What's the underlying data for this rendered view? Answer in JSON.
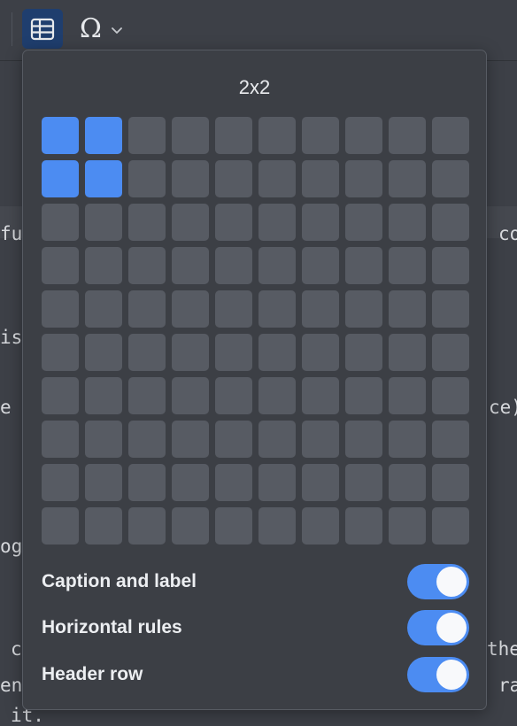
{
  "toolbar": {
    "table_button_icon": "table-grid-icon",
    "special_char_icon": "omega-icon",
    "special_char_glyph": "Ω",
    "dropdown_icon": "chevron-down-icon"
  },
  "background_text": [
    {
      "text": "fu"
    },
    {
      "text": "co"
    },
    {
      "text": "is"
    },
    {
      "text": "e"
    },
    {
      "text": "ce)"
    },
    {
      "text": "og"
    },
    {
      "text": "c"
    },
    {
      "text": "the"
    },
    {
      "text": "en"
    },
    {
      "text": "ra"
    },
    {
      "text": "it."
    }
  ],
  "table_picker": {
    "size_label": "2x2",
    "columns": 10,
    "rows": 10,
    "selected_cols": 2,
    "selected_rows": 2,
    "options": [
      {
        "label": "Caption and label",
        "on": true
      },
      {
        "label": "Horizontal rules",
        "on": true
      },
      {
        "label": "Header row",
        "on": true
      }
    ]
  },
  "colors": {
    "accent": "#4c8cf2",
    "cell": "#575b63",
    "popup_bg": "#3c3f45",
    "app_bg": "#3d4047"
  }
}
